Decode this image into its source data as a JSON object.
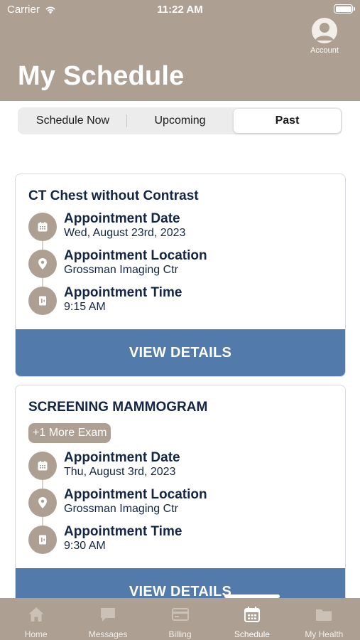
{
  "status_bar": {
    "carrier": "Carrier",
    "time": "11:22 AM"
  },
  "header": {
    "title": "My Schedule",
    "account_label": "Account"
  },
  "segments": [
    {
      "label": "Schedule Now",
      "active": false
    },
    {
      "label": "Upcoming",
      "active": false
    },
    {
      "label": "Past",
      "active": true
    }
  ],
  "appointments": [
    {
      "title": "CT Chest without Contrast",
      "extra_exams": null,
      "date_label": "Appointment Date",
      "date_value": "Wed, August 23rd, 2023",
      "location_label": "Appointment Location",
      "location_value": "Grossman Imaging Ctr",
      "time_label": "Appointment Time",
      "time_value": "9:15 AM",
      "button_label": "VIEW DETAILS"
    },
    {
      "title": "SCREENING MAMMOGRAM",
      "extra_exams": "+1 More Exam",
      "date_label": "Appointment Date",
      "date_value": "Thu, August 3rd, 2023",
      "location_label": "Appointment Location",
      "location_value": "Grossman Imaging Ctr",
      "time_label": "Appointment Time",
      "time_value": "9:30 AM",
      "button_label": "VIEW DETAILS"
    }
  ],
  "tabbar": [
    {
      "label": "Home",
      "icon": "home-icon"
    },
    {
      "label": "Messages",
      "icon": "message-icon"
    },
    {
      "label": "Billing",
      "icon": "credit-card-icon"
    },
    {
      "label": "Schedule",
      "icon": "calendar-icon",
      "active": true
    },
    {
      "label": "My Health",
      "icon": "folder-icon"
    }
  ],
  "colors": {
    "header_bg": "#ad9f91",
    "accent_button": "#527aab",
    "text_dark": "#142544",
    "tab_inactive": "#c9bfb4"
  }
}
